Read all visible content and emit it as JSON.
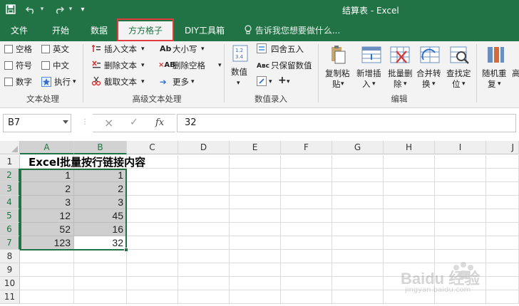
{
  "titlebar": {
    "title": "结算表 - Excel",
    "quick_access": {
      "save": "save-icon",
      "undo": "undo-icon",
      "redo": "redo-icon",
      "customize": "▾"
    }
  },
  "tabs": {
    "items": [
      {
        "label": "文件"
      },
      {
        "label": "开始"
      },
      {
        "label": "数据"
      },
      {
        "label": "方方格子",
        "active": true
      },
      {
        "label": "DIY工具箱"
      }
    ],
    "tell_me": "告诉我您想要做什么..."
  },
  "ribbon": {
    "text_processing": {
      "checkboxes": [
        "空格",
        "英文",
        "符号",
        "中文",
        "数字"
      ],
      "execute": "执行",
      "label": "文本处理"
    },
    "advanced_text": {
      "insert_text": "插入文本",
      "delete_text": "删除文本",
      "extract_text": "截取文本",
      "case": "大小写",
      "delete_spaces": "删除空格",
      "more": "更多",
      "label": "高级文本处理"
    },
    "numeric_entry": {
      "value": "数值",
      "round": "四舍五入",
      "keep_value": "只保留数值",
      "label": "数值录入"
    },
    "edit": {
      "copy_paste": [
        "复制粘",
        "贴"
      ],
      "insert_new": [
        "新增插",
        "入"
      ],
      "batch_delete": [
        "批量删",
        "除"
      ],
      "merge_convert": [
        "合并转",
        "换"
      ],
      "find_locate": [
        "查找定",
        "位"
      ],
      "random_repeat": [
        "随机重",
        "复"
      ],
      "more_cut": "高",
      "label": "编辑"
    }
  },
  "formula_bar": {
    "name_box": "B7",
    "cancel_icon": "×",
    "enter_icon": "✓",
    "fx_label": "fx",
    "formula": "32"
  },
  "sheet": {
    "columns": [
      "A",
      "B",
      "C",
      "D",
      "E",
      "F",
      "G",
      "H",
      "I",
      "J"
    ],
    "rows": [
      "1",
      "2",
      "3",
      "4",
      "5",
      "6",
      "7",
      "8",
      "9",
      "10",
      "11"
    ],
    "title": "Excel批量按行链接内容",
    "data": [
      [
        "1",
        "1"
      ],
      [
        "2",
        "2"
      ],
      [
        "3",
        "3"
      ],
      [
        "12",
        "45"
      ],
      [
        "52",
        "16"
      ],
      [
        "123",
        "32"
      ]
    ]
  },
  "watermark": {
    "brand": "Baidu 经验",
    "url": "jingyan.baidu.com"
  },
  "colors": {
    "excel_green": "#217346",
    "highlight_red": "#e23b3b"
  }
}
